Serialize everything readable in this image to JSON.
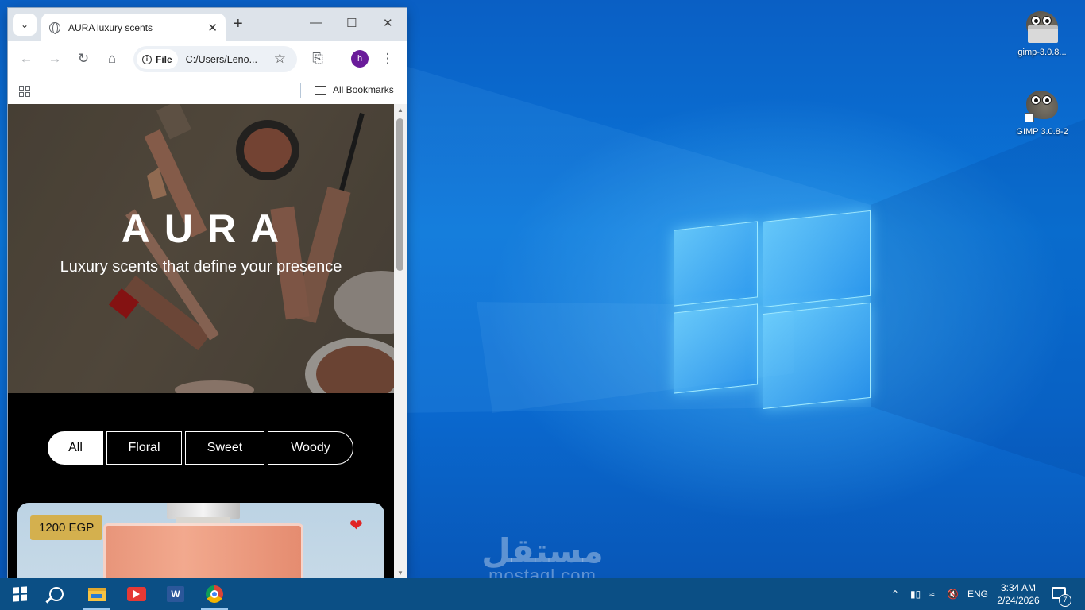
{
  "browser": {
    "tab_title": "AURA luxury scents",
    "new_tab_symbol": "+",
    "address_chip": "File",
    "url": "C:/Users/Leno...",
    "profile_initial": "h",
    "bookmarks_label": "All Bookmarks"
  },
  "page": {
    "hero_title": "AURA",
    "hero_subtitle": "Luxury scents that define your presence",
    "filters": [
      {
        "label": "All",
        "active": true
      },
      {
        "label": "Floral",
        "active": false
      },
      {
        "label": "Sweet",
        "active": false
      },
      {
        "label": "Woody",
        "active": false
      }
    ],
    "product": {
      "price": "1200 EGP",
      "favorite_icon": "heart-icon"
    }
  },
  "desktop": {
    "icons": [
      {
        "label": "gimp-3.0.8...",
        "icon": "gimp-installer-icon"
      },
      {
        "label": "GIMP 3.0.8-2",
        "icon": "gimp-shortcut-icon"
      }
    ],
    "watermark_arabic": "مستقل",
    "watermark_latin": "mostaql.com"
  },
  "taskbar": {
    "apps": [
      "windows-start",
      "search",
      "file-explorer",
      "youtube",
      "word",
      "chrome"
    ],
    "language": "ENG",
    "time": "3:34 AM",
    "date": "2/24/2026",
    "notification_count": "7"
  },
  "colors": {
    "price_badge": "#d4b04e",
    "heart": "#e02424",
    "taskbar": "#0b4f85",
    "profile": "#6a1b9a"
  }
}
